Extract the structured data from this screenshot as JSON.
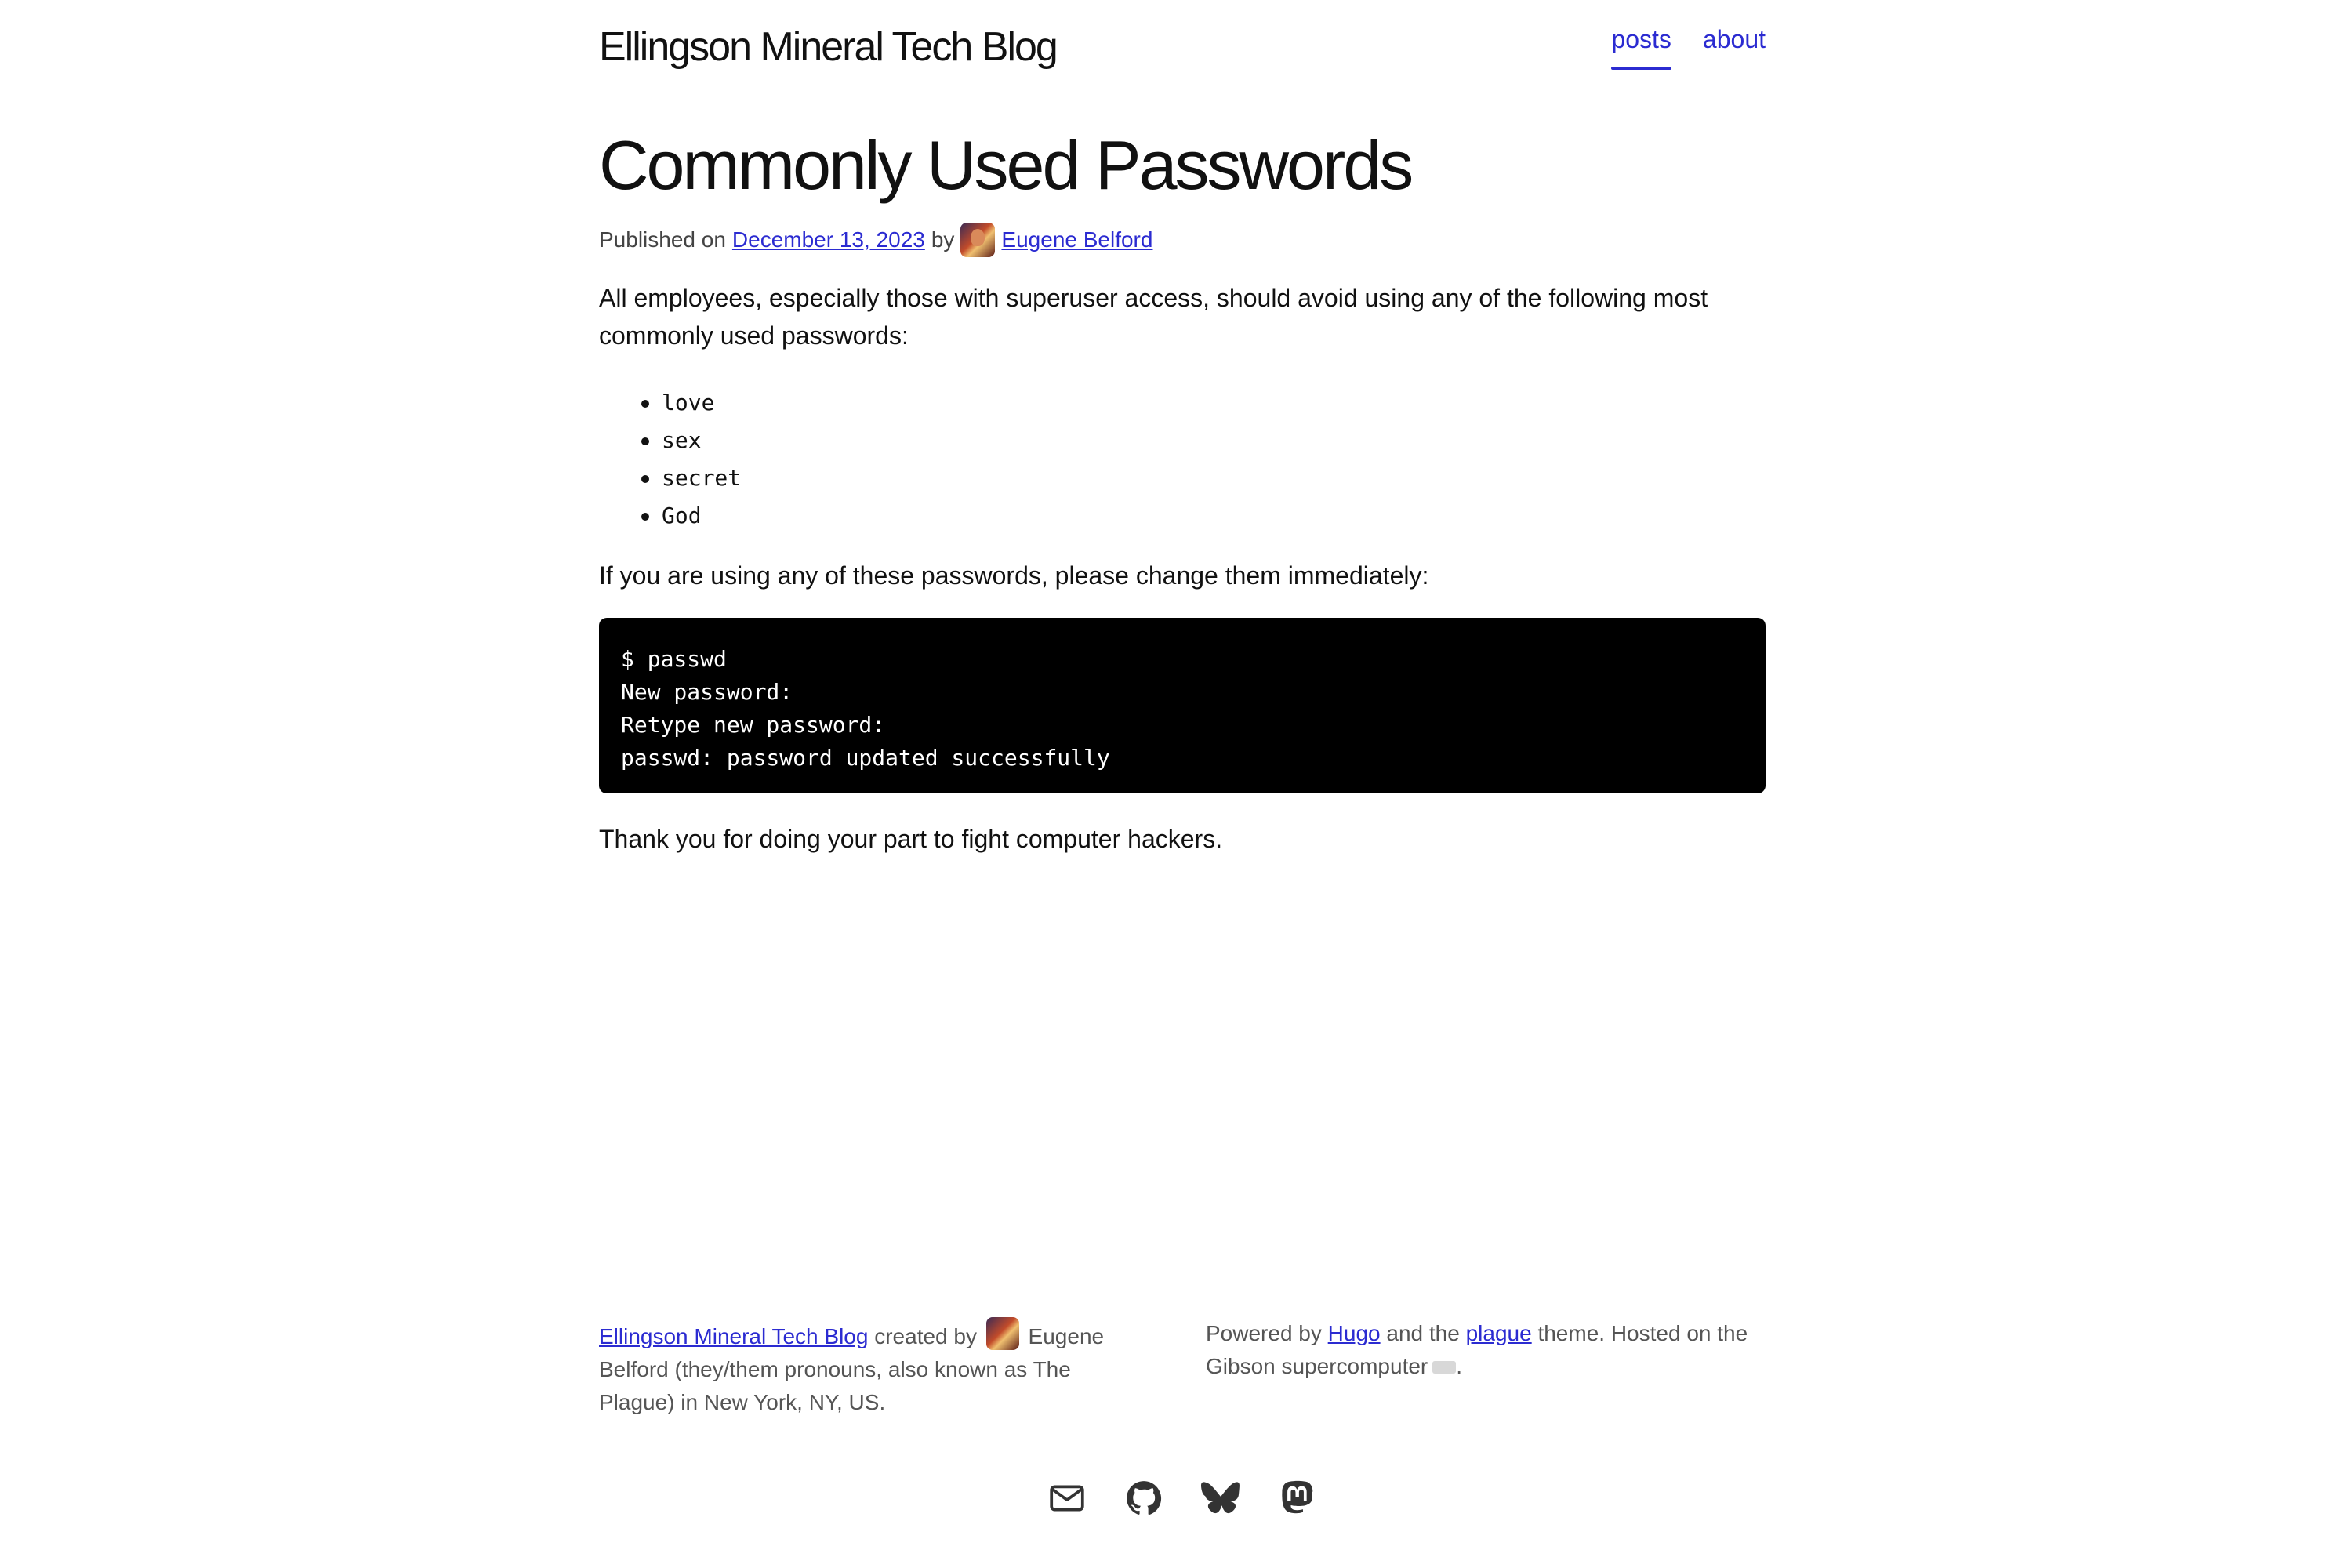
{
  "site": {
    "title": "Ellingson Mineral Tech Blog",
    "nav": [
      {
        "label": "posts",
        "active": true
      },
      {
        "label": "about",
        "active": false
      }
    ]
  },
  "post": {
    "title": "Commonly Used Passwords",
    "meta": {
      "published_prefix": "Published on",
      "date": "December 13, 2023",
      "by": "by",
      "author": "Eugene Belford"
    },
    "paragraph1": "All employees, especially those with superuser access, should avoid using any of the following most commonly used passwords:",
    "passwords": [
      "love",
      "sex",
      "secret",
      "God"
    ],
    "paragraph2": "If you are using any of these passwords, please change them immediately:",
    "code_lines": [
      "$ passwd",
      "New password:",
      "Retype new password:",
      "passwd: password updated successfully"
    ],
    "paragraph3": "Thank you for doing your part to fight computer hackers."
  },
  "footer": {
    "left": {
      "blog_link": "Ellingson Mineral Tech Blog",
      "created_by": "created by",
      "text": "Eugene Belford (they/them pronouns, also known as The Plague) in New York, NY, US."
    },
    "right": {
      "powered_by": "Powered by",
      "hugo": "Hugo",
      "and_the": "and the",
      "plague": "plague",
      "rest": "theme. Hosted on the Gibson supercomputer",
      "end": "."
    },
    "social_icons": [
      "mail-icon",
      "github-icon",
      "bluesky-icon",
      "mastodon-icon"
    ]
  },
  "colors": {
    "link": "#2b2bd1",
    "code_bg": "#000000",
    "text": "#111111"
  }
}
